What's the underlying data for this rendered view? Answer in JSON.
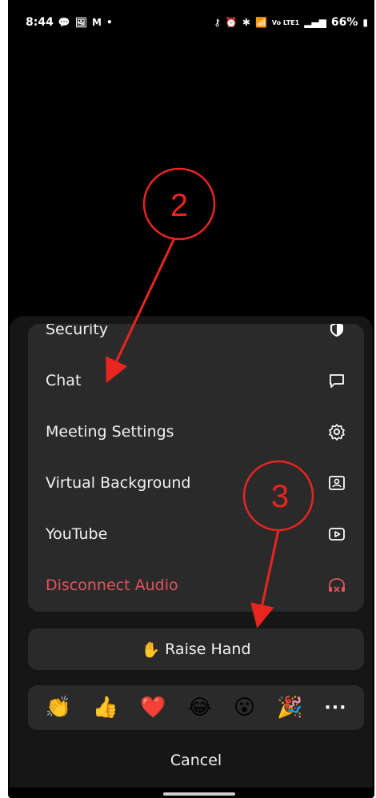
{
  "status_bar": {
    "time": "8:44",
    "left_icons": [
      "chat-bubble-icon",
      "image-icon",
      "gmail-icon",
      "dot"
    ],
    "right_icons": [
      "key-icon",
      "alarm-icon",
      "bluetooth-icon",
      "wifi-icon",
      "signal-icon"
    ],
    "network": "Vo LTE1",
    "battery": "66%"
  },
  "menu": {
    "items": [
      {
        "label": "Security",
        "icon": "shield-icon"
      },
      {
        "label": "Chat",
        "icon": "chat-bubble-icon"
      },
      {
        "label": "Meeting Settings",
        "icon": "gear-icon"
      },
      {
        "label": "Virtual Background",
        "icon": "portrait-icon"
      },
      {
        "label": "YouTube",
        "icon": "play-icon"
      },
      {
        "label": "Disconnect Audio",
        "icon": "headphones-x-icon",
        "color": "#e4545b"
      }
    ]
  },
  "raise_hand": {
    "emoji": "✋",
    "label": "Raise Hand"
  },
  "reactions": {
    "items": [
      "👏",
      "👍",
      "❤️",
      "😂",
      "😮",
      "🎉"
    ],
    "more": "···"
  },
  "cancel_label": "Cancel",
  "annotations": {
    "step2": "2",
    "step3": "3",
    "color": "#e8251f"
  }
}
